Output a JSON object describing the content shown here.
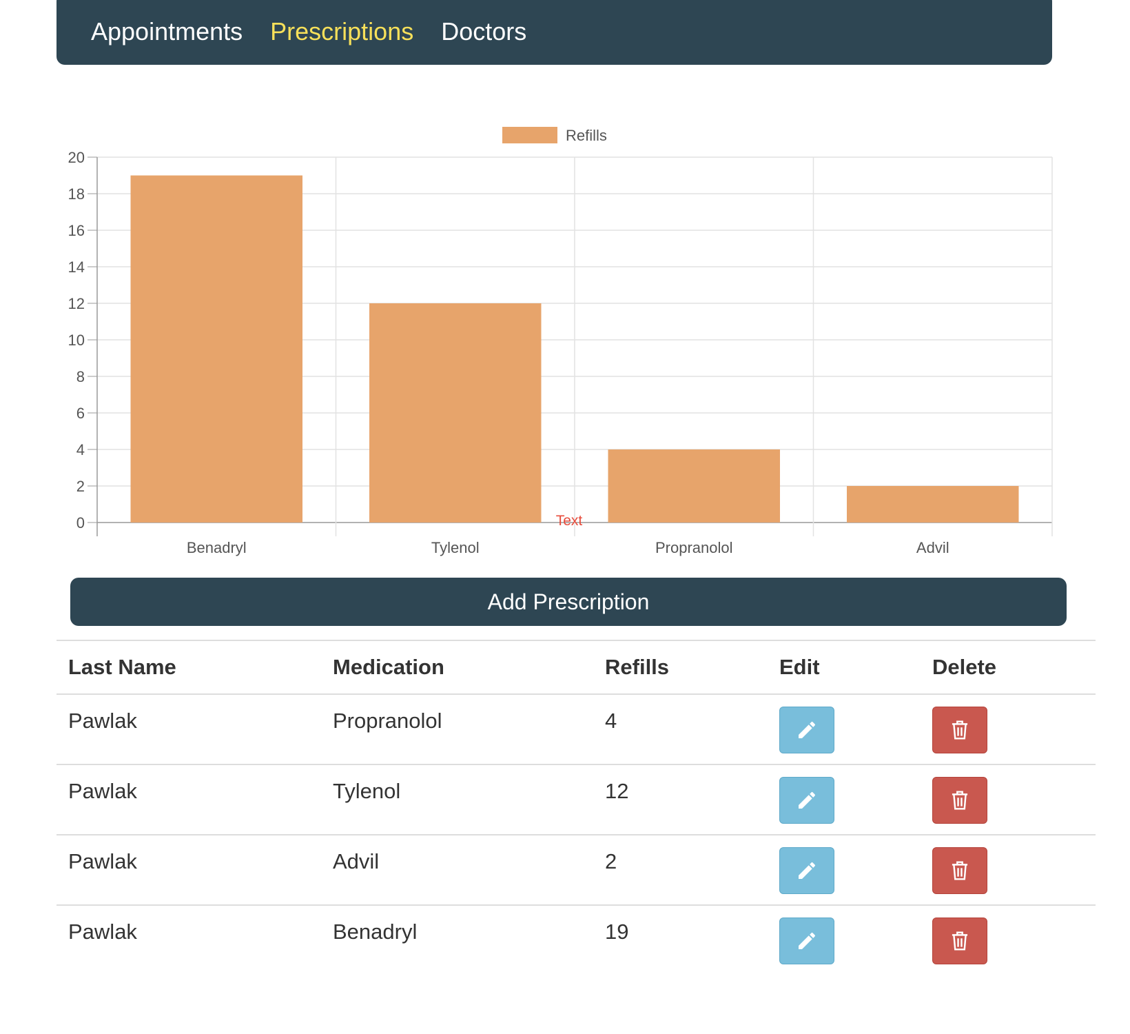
{
  "nav": {
    "items": [
      {
        "label": "Appointments",
        "active": false
      },
      {
        "label": "Prescriptions",
        "active": true
      },
      {
        "label": "Doctors",
        "active": false
      }
    ]
  },
  "chart_data": {
    "type": "bar",
    "categories": [
      "Benadryl",
      "Tylenol",
      "Propranolol",
      "Advil"
    ],
    "series": [
      {
        "name": "Refills",
        "values": [
          19,
          12,
          4,
          2
        ],
        "color": "#e7a46b"
      }
    ],
    "ylim": [
      0,
      20
    ],
    "yticks": [
      0,
      2,
      4,
      6,
      8,
      10,
      12,
      14,
      16,
      18,
      20
    ],
    "grid": true,
    "legend": "top-center",
    "annotation": {
      "text": "Text",
      "color": "#e74c3c"
    }
  },
  "add_button": {
    "label": "Add Prescription"
  },
  "table": {
    "headers": {
      "last_name": "Last Name",
      "medication": "Medication",
      "refills": "Refills",
      "edit": "Edit",
      "delete": "Delete"
    },
    "rows": [
      {
        "last_name": "Pawlak",
        "medication": "Propranolol",
        "refills": "4"
      },
      {
        "last_name": "Pawlak",
        "medication": "Tylenol",
        "refills": "12"
      },
      {
        "last_name": "Pawlak",
        "medication": "Advil",
        "refills": "2"
      },
      {
        "last_name": "Pawlak",
        "medication": "Benadryl",
        "refills": "19"
      }
    ],
    "edit_icon": "pencil-icon",
    "delete_icon": "trash-icon",
    "colors": {
      "edit": "#79bedb",
      "delete": "#c9584f"
    }
  }
}
